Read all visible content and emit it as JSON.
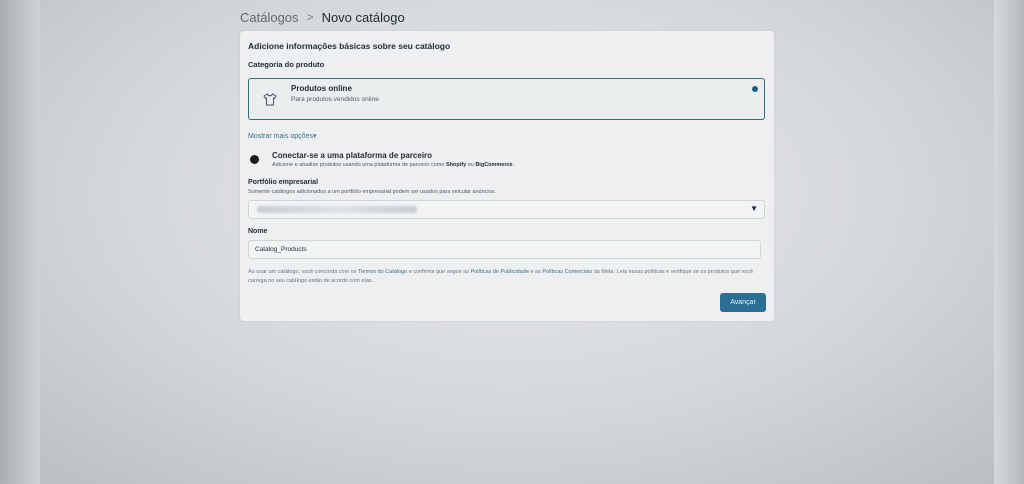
{
  "breadcrumb": {
    "parent": "Catálogos",
    "separator": ">",
    "current": "Novo catálogo"
  },
  "form": {
    "heading": "Adicione informações básicas sobre seu catálogo",
    "category_label": "Categoria do produto",
    "selected_option": {
      "title": "Produtos online",
      "description": "Para produtos vendidos online",
      "icon": "tshirt-icon",
      "selected": true
    },
    "more_options": "Mostrar mais opções▾",
    "partner_option": {
      "title": "Conectar-se a uma plataforma de parceiro",
      "desc_prefix": "Adicione e atualize produtos usando uma plataforma de parceiro como ",
      "shopify": "Shopify",
      "desc_mid": " ou ",
      "bigcommerce": "BigCommerce",
      "desc_suffix": "."
    },
    "portfolio": {
      "label": "Portfólio empresarial",
      "help": "Somente catálogos adicionados a um portfólio empresarial podem ser usados para veicular anúncios.",
      "caret": "▼"
    },
    "name": {
      "label": "Nome",
      "value": "Catalog_Products"
    },
    "terms": {
      "part1": "Ao usar um catálogo, você concorda com os ",
      "link1": "Termos do Catálogo",
      "part2": " e confirma que segue as ",
      "link2": "Políticas de Publicidade",
      "part3": " e as ",
      "link3": "Políticas Comerciais",
      "part4": " da Meta. Leia essas políticas e verifique se os produtos que você carrega no seu catálogo estão de acordo com elas."
    },
    "next_button": "Avançar"
  },
  "colors": {
    "accent": "#2b6f97",
    "selected_border": "#2d6e80",
    "link": "#3a6f8e"
  }
}
